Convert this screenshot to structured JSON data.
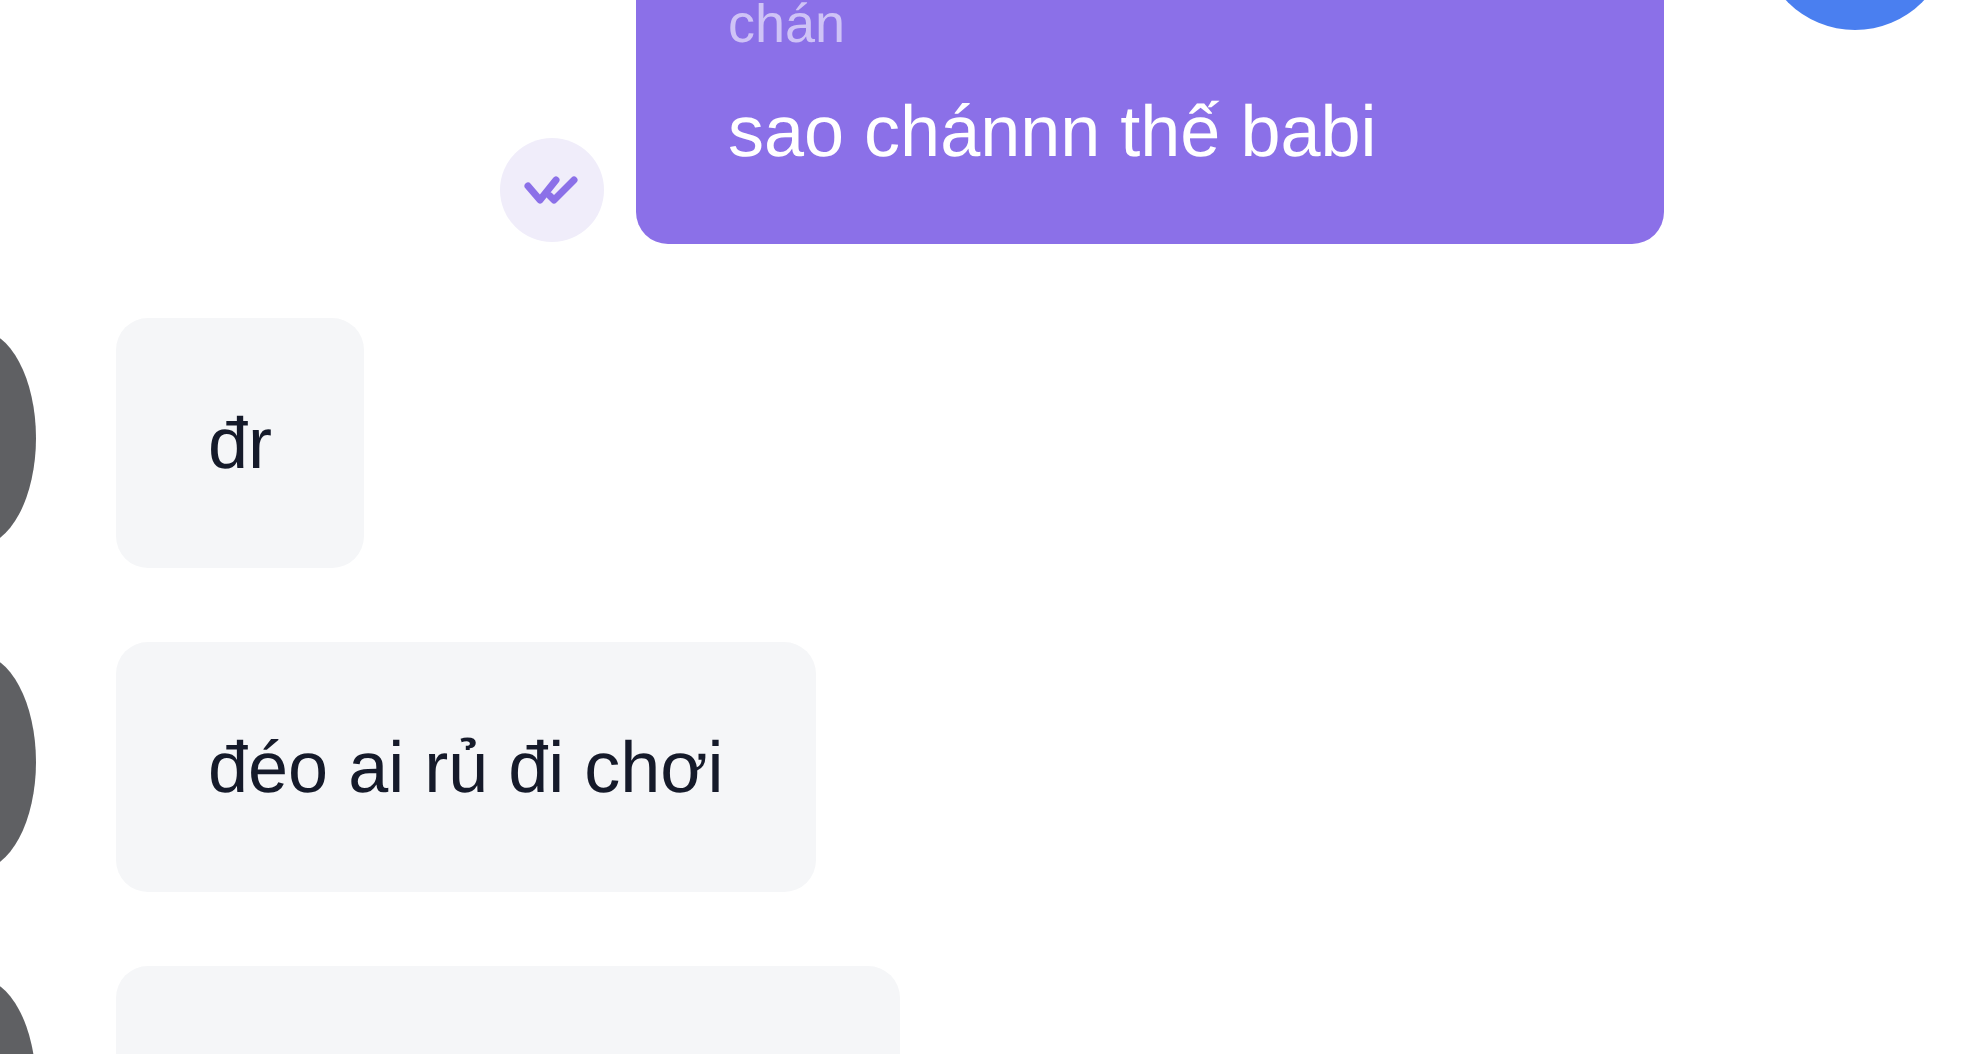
{
  "messages": [
    {
      "kind": "outgoing",
      "lines": [
        "chán",
        "sao chánnn thế babi"
      ],
      "read": true
    },
    {
      "kind": "incoming",
      "text": "đr"
    },
    {
      "kind": "incoming",
      "text": "đéo ai rủ đi chơi"
    },
    {
      "kind": "incoming"
    }
  ]
}
